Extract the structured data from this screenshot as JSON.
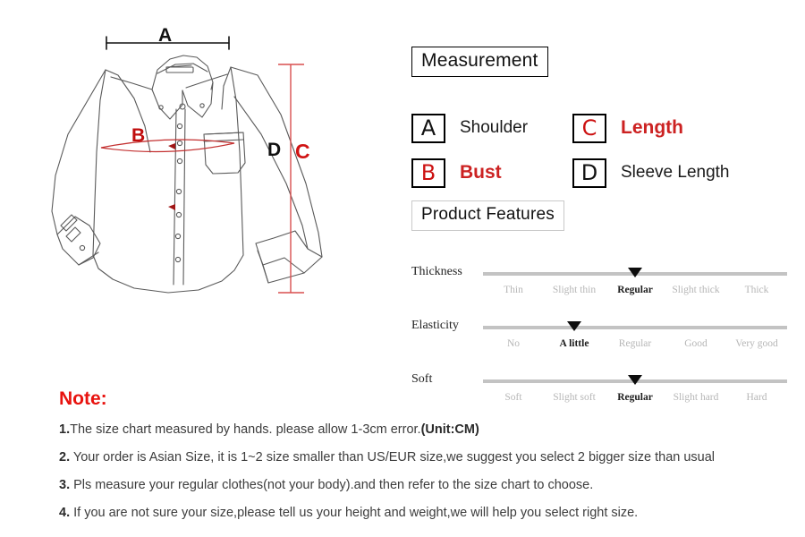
{
  "diagram": {
    "letters": {
      "a": "A",
      "b": "B",
      "c": "C",
      "d": "D"
    },
    "colors": {
      "measure_red": "#d01414",
      "outline": "#555555"
    }
  },
  "measurement": {
    "title": "Measurement",
    "entries": [
      {
        "letter": "A",
        "letter_color": "black",
        "label": "Shoulder",
        "label_color": "black"
      },
      {
        "letter": "C",
        "letter_color": "red",
        "label": "Length",
        "label_color": "red"
      },
      {
        "letter": "B",
        "letter_color": "red",
        "label": "Bust",
        "label_color": "red"
      },
      {
        "letter": "D",
        "letter_color": "black",
        "label": "Sleeve Length",
        "label_color": "black"
      }
    ]
  },
  "product_features": {
    "title": "Product Features",
    "rows": [
      {
        "name": "Thickness",
        "scale": [
          "Thin",
          "Slight thin",
          "Regular",
          "Slight thick",
          "Thick"
        ],
        "selected_index": 2,
        "selected_value": "Regular"
      },
      {
        "name": "Elasticity",
        "scale": [
          "No",
          "A little",
          "Regular",
          "Good",
          "Very good"
        ],
        "selected_index": 1,
        "selected_value": "A little"
      },
      {
        "name": "Soft",
        "scale": [
          "Soft",
          "Slight soft",
          "Regular",
          "Slight hard",
          "Hard"
        ],
        "selected_index": 2,
        "selected_value": "Regular"
      }
    ]
  },
  "notes": {
    "heading": "Note:",
    "items": [
      {
        "num": "1.",
        "text": "The size chart measured by hands.  please allow 1-3cm error.",
        "emphasis": "(Unit:CM)"
      },
      {
        "num": "2.",
        "text": " Your order is Asian Size, it is 1~2 size smaller than US/EUR size,we suggest you select 2 bigger size than usual",
        "emphasis": ""
      },
      {
        "num": "3.",
        "text": " Pls measure your regular clothes(not your body).and then refer to the size chart to choose.",
        "emphasis": ""
      },
      {
        "num": "4.",
        "text": " If you are not sure your size,please tell us your height and weight,we will help you select right size.",
        "emphasis": ""
      }
    ]
  }
}
